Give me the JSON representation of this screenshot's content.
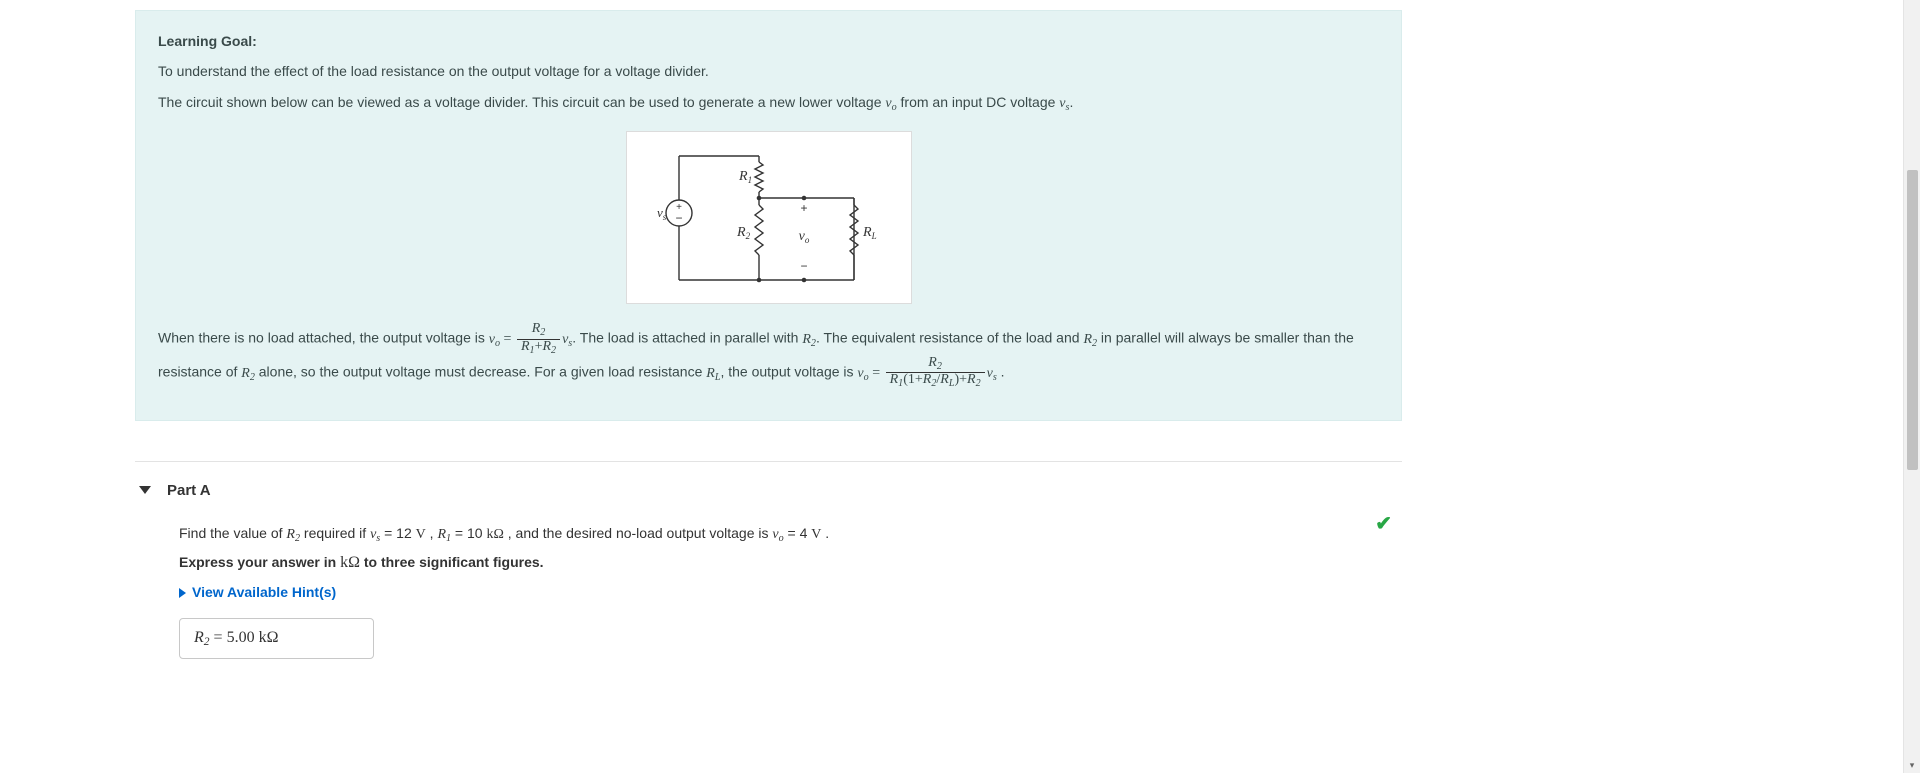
{
  "intro": {
    "heading": "Learning Goal:",
    "goal_text": "To understand the effect of the load resistance on the output voltage for a voltage divider.",
    "circuit_text_pre": "The circuit shown below can be viewed as a voltage divider. This circuit can be used to generate a new lower voltage ",
    "vo": "v",
    "vo_sub": "o",
    "circuit_text_mid": " from an input DC voltage ",
    "vs": "v",
    "vs_sub": "s",
    "circuit_text_post": "."
  },
  "circuit_labels": {
    "vs": "v",
    "vs_sub": "s",
    "r1": "R",
    "r1_sub": "1",
    "r2": "R",
    "r2_sub": "2",
    "vo": "v",
    "vo_sub": "o",
    "rl": "R",
    "rl_sub": "L",
    "plus": "+",
    "minus": "−"
  },
  "explain": {
    "p1a": "When there is no load attached, the output voltage is ",
    "eq1_lhs_v": "v",
    "eq1_lhs_sub": "o",
    "eq1_eq": " = ",
    "eq1_num_r": "R",
    "eq1_num_sub": "2",
    "eq1_den_r1": "R",
    "eq1_den_sub1": "1",
    "eq1_den_plus": "+",
    "eq1_den_r2": "R",
    "eq1_den_sub2": "2",
    "eq1_rhs_v": "v",
    "eq1_rhs_sub": "s",
    "p1b": ". The load is attached in parallel with ",
    "r2a": "R",
    "r2a_sub": "2",
    "p1c": ". The equivalent resistance of the load and ",
    "r2b": "R",
    "r2b_sub": "2",
    "p1d": " in parallel will always be smaller than the resistance of ",
    "r2c": "R",
    "r2c_sub": "2",
    "p1e": " alone, so the output voltage must decrease. For a given load resistance ",
    "rl": "R",
    "rl_sub": "L",
    "p1f": ", the output voltage is ",
    "eq2_lhs_v": "v",
    "eq2_lhs_sub": "o",
    "eq2_eq": " = ",
    "eq2_num_r": "R",
    "eq2_num_sub": "2",
    "eq2_den": "R₁(1+R₂/R_L)+R₂",
    "eq2_den_r1": "R",
    "eq2_den_sub1": "1",
    "eq2_den_lp": "(1+",
    "eq2_den_r2": "R",
    "eq2_den_sub2": "2",
    "eq2_den_slash": "/",
    "eq2_den_rl": "R",
    "eq2_den_subl": "L",
    "eq2_den_rp": ")+",
    "eq2_den_r2b": "R",
    "eq2_den_sub2b": "2",
    "eq2_rhs_v": "v",
    "eq2_rhs_sub": "s",
    "p1g": " ."
  },
  "partA": {
    "label": "Part A",
    "q_a": "Find the value of ",
    "r2": "R",
    "r2_sub": "2",
    "q_b": " required if ",
    "vs": "v",
    "vs_sub": "s",
    "vs_val": " = 12 ",
    "vs_unit": "V",
    "q_c": " , ",
    "r1": "R",
    "r1_sub": "1",
    "r1_val": " = 10 ",
    "r1_unit": "kΩ",
    "q_d": " , and the desired no-load output voltage is ",
    "vo": "v",
    "vo_sub": "o",
    "vo_val": " = 4 ",
    "vo_unit": "V",
    "q_e": " .",
    "express_a": "Express your answer in ",
    "express_unit": "kΩ",
    "express_b": " to three significant figures.",
    "hint": "View Available Hint(s)",
    "ans_r": "R",
    "ans_sub": "2",
    "ans_eq": " = ",
    "ans_val": "5.00",
    "ans_sp": "  ",
    "ans_unit": "kΩ"
  }
}
